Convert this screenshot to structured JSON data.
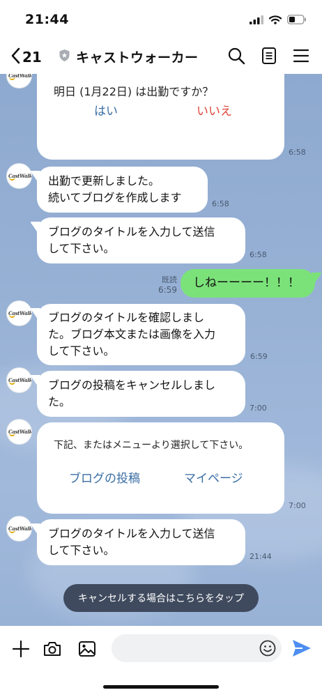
{
  "status_bar": {
    "time": "21:44"
  },
  "header": {
    "back_count": "21",
    "title": "キャストウォーカー"
  },
  "avatar_text": "CastWalker",
  "messages": {
    "m1": {
      "question": "明日 (1月22日) は出勤ですか？",
      "yes": "はい",
      "no": "いいえ",
      "time": "6:58"
    },
    "m2": {
      "lines": [
        "出勤で更新しました。",
        "続いてブログを作成します"
      ],
      "time": "6:58"
    },
    "m3": {
      "lines": [
        "ブログのタイトルを入力して送信",
        "して下さい。"
      ],
      "time": "6:58"
    },
    "m4": {
      "text": "しねーーーー！！！",
      "read": "既読",
      "time": "6:59"
    },
    "m5": {
      "lines": [
        "ブログのタイトルを確認しまし",
        "た。ブログ本文または画像を入力",
        "して下さい。"
      ],
      "time": "6:59"
    },
    "m6": {
      "lines": [
        "ブログの投稿をキャンセルしまし",
        "た。"
      ],
      "time": "7:00"
    },
    "m7": {
      "prompt": "下記、またはメニューより選択して下さい。",
      "option1": "ブログの投稿",
      "option2": "マイページ",
      "time": "7:00"
    },
    "m8": {
      "lines": [
        "ブログのタイトルを入力して送信",
        "して下さい。"
      ],
      "time": "21:44"
    }
  },
  "cancel_banner": "キャンセルする場合はこちらをタップ",
  "input": {
    "placeholder": ""
  },
  "colors": {
    "sent_bubble": "#7be27a",
    "yes_button": "#3a6ea5",
    "no_button": "#e0453a",
    "option_link": "#3a6ea5",
    "send_icon": "#4d8ef0",
    "banner": "#3f4a5e"
  },
  "icons": [
    "back-chevron-icon",
    "shield-icon",
    "search-icon",
    "notes-icon",
    "menu-icon",
    "plus-icon",
    "camera-icon",
    "image-icon",
    "emoji-icon",
    "send-icon",
    "signal-icon",
    "wifi-icon",
    "battery-icon"
  ]
}
